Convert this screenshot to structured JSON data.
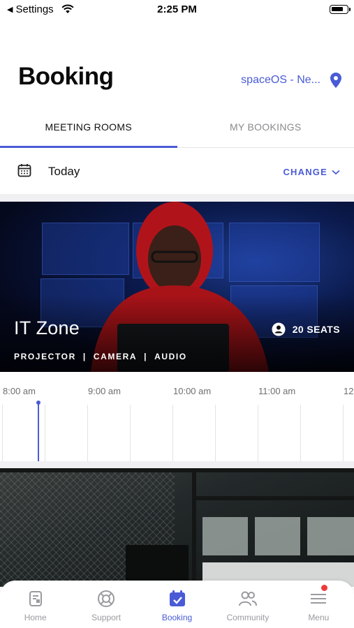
{
  "status_bar": {
    "back_label": "Settings",
    "time": "2:25 PM"
  },
  "header": {
    "title": "Booking",
    "location": "spaceOS - Ne..."
  },
  "tabs": [
    {
      "label": "MEETING ROOMS",
      "active": true
    },
    {
      "label": "MY BOOKINGS",
      "active": false
    }
  ],
  "date_row": {
    "label": "Today",
    "change_label": "CHANGE"
  },
  "room": {
    "name": "IT Zone",
    "seats": "20 SEATS",
    "features": [
      "PROJECTOR",
      "|",
      "CAMERA",
      "|",
      "AUDIO"
    ]
  },
  "timeline": {
    "times": [
      "8:00 am",
      "9:00 am",
      "10:00 am",
      "11:00 am",
      "12"
    ]
  },
  "bottom_nav": [
    {
      "label": "Home",
      "icon": "home-icon",
      "active": false
    },
    {
      "label": "Support",
      "icon": "support-icon",
      "active": false
    },
    {
      "label": "Booking",
      "icon": "booking-icon",
      "active": true
    },
    {
      "label": "Community",
      "icon": "community-icon",
      "active": false
    },
    {
      "label": "Menu",
      "icon": "menu-icon",
      "active": false,
      "badge": true
    }
  ],
  "colors": {
    "accent": "#4a5bd6",
    "badge": "#ef3b3b"
  }
}
